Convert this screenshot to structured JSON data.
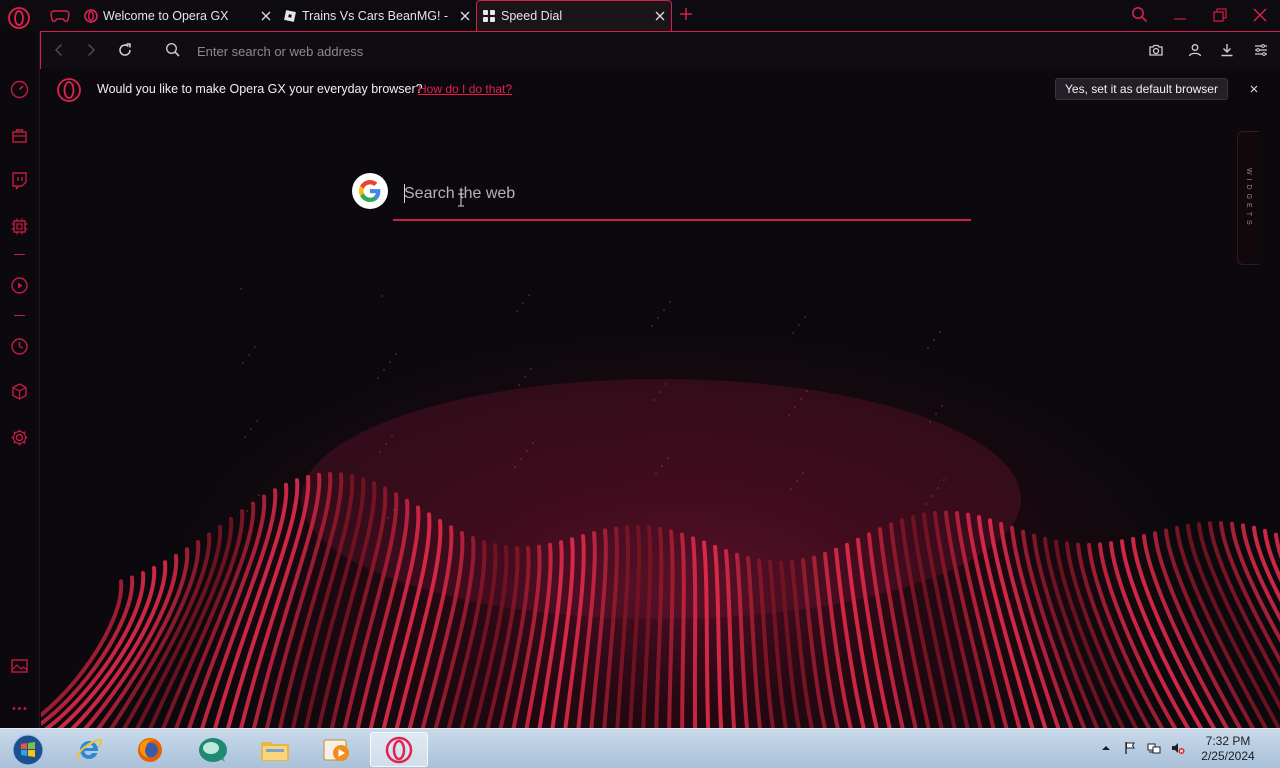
{
  "browser": {
    "name": "Opera GX",
    "accent": "#d6204a"
  },
  "tabs": [
    {
      "title": "Welcome to Opera GX",
      "favicon": "opera-icon",
      "active": false
    },
    {
      "title": "Trains Vs Cars BeanMG! - Roblox",
      "favicon": "roblox-icon",
      "active": false
    },
    {
      "title": "Speed Dial",
      "favicon": "speed-dial-icon",
      "active": true
    }
  ],
  "address_bar": {
    "placeholder": "Enter search or web address",
    "value": ""
  },
  "sidebar": {
    "items": [
      "gx-control-icon",
      "shopping-bag-icon",
      "twitch-icon",
      "gx-cleaner-icon",
      "player-icon",
      "history-icon",
      "extensions-icon",
      "settings-icon",
      "wallpaper-icon",
      "more-icon"
    ]
  },
  "infobar": {
    "message": "Would you like to make Opera GX your everyday browser?",
    "link": "How do I do that?",
    "button": "Yes, set it as default browser"
  },
  "speed_dial": {
    "search_placeholder": "Search the web",
    "search_engine": "google-icon",
    "widgets_label": "WIDGETS"
  },
  "taskbar": {
    "apps": [
      "start-orb",
      "internet-explorer-icon",
      "firefox-icon",
      "app-icon",
      "file-explorer-icon",
      "media-player-icon",
      "opera-gx-icon"
    ],
    "time": "7:32 PM",
    "date": "2/25/2024"
  }
}
